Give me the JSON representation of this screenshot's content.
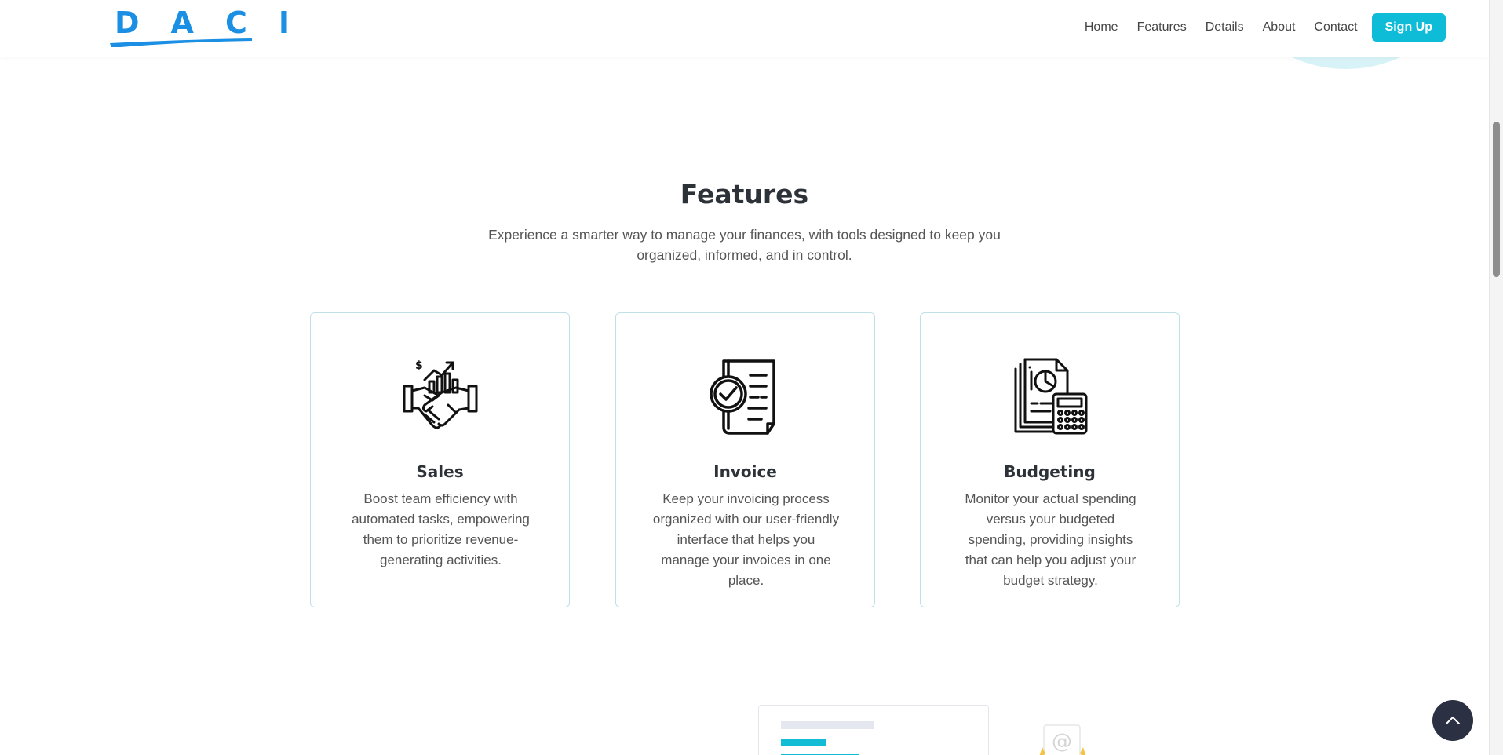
{
  "header": {
    "logo_text": "DACI",
    "nav": [
      "Home",
      "Features",
      "Details",
      "About",
      "Contact"
    ],
    "signup_label": "Sign Up"
  },
  "features": {
    "title": "Features",
    "subtitle": "Experience a smarter way to manage your finances, with tools designed to keep you organized, informed, and in control.",
    "cards": [
      {
        "icon": "handshake-growth-icon",
        "title": "Sales",
        "text": "Boost team efficiency with automated tasks, empowering them to prioritize revenue-generating activities."
      },
      {
        "icon": "invoice-check-icon",
        "title": "Invoice",
        "text": "Keep your invoicing process organized with our user-friendly interface that helps you manage your invoices in one place."
      },
      {
        "icon": "report-calculator-icon",
        "title": "Budgeting",
        "text": "Monitor your actual spending versus your budgeted spending, providing insights that can help you adjust your budget strategy."
      }
    ]
  },
  "colors": {
    "brand_blue": "#1a8fe3",
    "accent_cyan": "#0fbcd8",
    "card_border": "#bfe0e4",
    "back_to_top_bg": "#2b3143"
  },
  "icons": {
    "back_to_top": "chevron-up-icon",
    "mail": "email-at-icon"
  }
}
